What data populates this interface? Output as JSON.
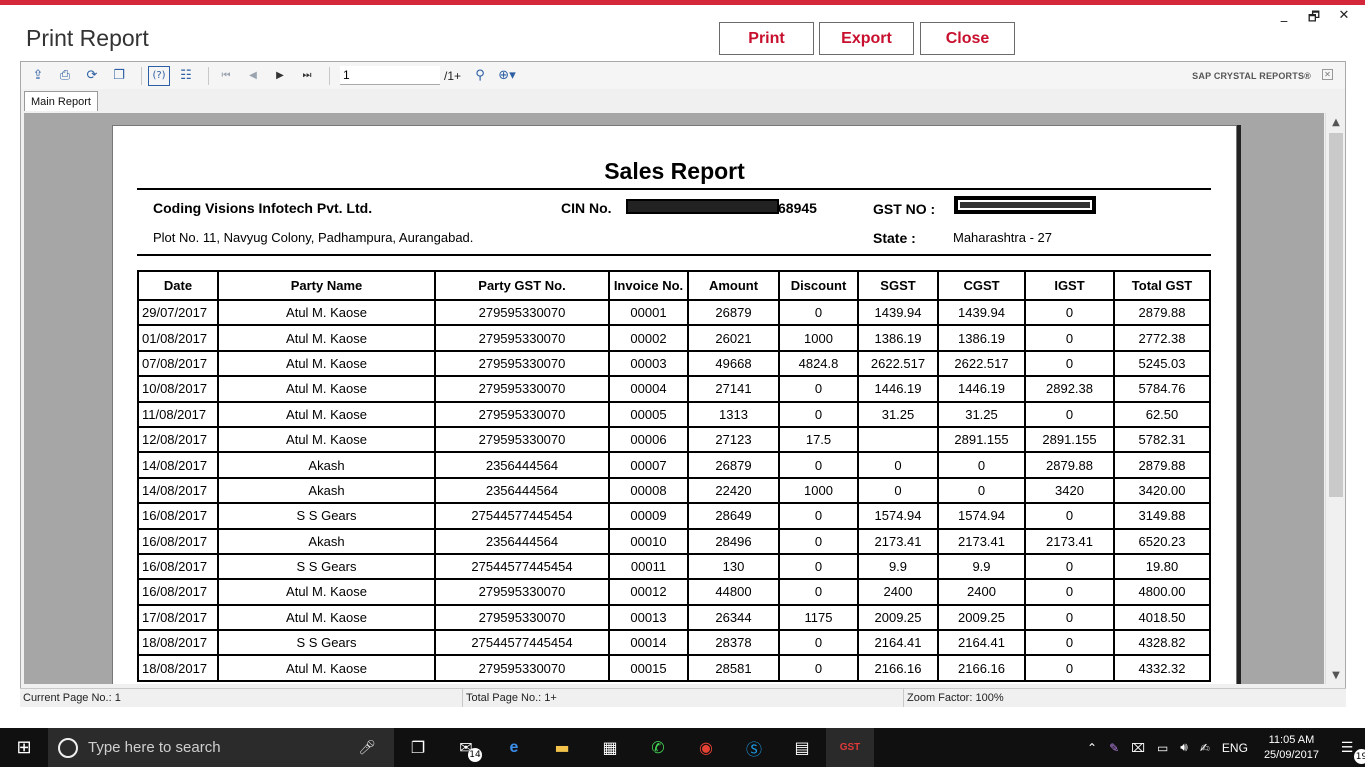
{
  "window": {
    "title": "Print Report",
    "buttons": {
      "print": "Print",
      "export": "Export",
      "close": "Close"
    },
    "controls": {
      "minimize": "_",
      "restore": "🗗",
      "close": "✕"
    }
  },
  "viewer": {
    "page_input": "1",
    "page_of": "/1+",
    "brand": "SAP CRYSTAL REPORTS®",
    "tab": "Main Report",
    "toolbar_icons": [
      "export-icon",
      "print-icon",
      "refresh-icon",
      "copy-icon",
      "help-icon",
      "group-tree-icon",
      "first-page-icon",
      "prev-page-icon",
      "next-page-icon",
      "last-page-icon",
      "find-icon",
      "zoom-icon"
    ]
  },
  "report": {
    "title": "Sales Report",
    "company_name": "Coding Visions Infotech Pvt. Ltd.",
    "address": "Plot No. 11, Navyug Colony, Padhampura, Aurangabad.",
    "cin_label": "CIN No.",
    "cin_value": "68945",
    "gst_label": "GST NO :",
    "state_label": "State :",
    "state_value": "Maharashtra - 27",
    "columns": [
      "Date",
      "Party Name",
      "Party GST No.",
      "Invoice No.",
      "Amount",
      "Discount",
      "SGST",
      "CGST",
      "IGST",
      "Total GST"
    ],
    "rows": [
      [
        "29/07/2017",
        "Atul M. Kaose",
        "279595330070",
        "00001",
        "26879",
        "0",
        "1439.94",
        "1439.94",
        "0",
        "2879.88"
      ],
      [
        "01/08/2017",
        "Atul M. Kaose",
        "279595330070",
        "00002",
        "26021",
        "1000",
        "1386.19",
        "1386.19",
        "0",
        "2772.38"
      ],
      [
        "07/08/2017",
        "Atul M. Kaose",
        "279595330070",
        "00003",
        "49668",
        "4824.8",
        "2622.517",
        "2622.517",
        "0",
        "5245.03"
      ],
      [
        "10/08/2017",
        "Atul M. Kaose",
        "279595330070",
        "00004",
        "27141",
        "0",
        "1446.19",
        "1446.19",
        "2892.38",
        "5784.76"
      ],
      [
        "11/08/2017",
        "Atul M. Kaose",
        "279595330070",
        "00005",
        "1313",
        "0",
        "31.25",
        "31.25",
        "0",
        "62.50"
      ],
      [
        "12/08/2017",
        "Atul M. Kaose",
        "279595330070",
        "00006",
        "27123",
        "17.5",
        "",
        "2891.155",
        "2891.155",
        "5782.31"
      ],
      [
        "14/08/2017",
        "Akash",
        "2356444564",
        "00007",
        "26879",
        "0",
        "0",
        "0",
        "2879.88",
        "2879.88"
      ],
      [
        "14/08/2017",
        "Akash",
        "2356444564",
        "00008",
        "22420",
        "1000",
        "0",
        "0",
        "3420",
        "3420.00"
      ],
      [
        "16/08/2017",
        "S S Gears",
        "27544577445454",
        "00009",
        "28649",
        "0",
        "1574.94",
        "1574.94",
        "0",
        "3149.88"
      ],
      [
        "16/08/2017",
        "Akash",
        "2356444564",
        "00010",
        "28496",
        "0",
        "2173.41",
        "2173.41",
        "2173.41",
        "6520.23"
      ],
      [
        "16/08/2017",
        "S S Gears",
        "27544577445454",
        "00011",
        "130",
        "0",
        "9.9",
        "9.9",
        "0",
        "19.80"
      ],
      [
        "16/08/2017",
        "Atul M. Kaose",
        "279595330070",
        "00012",
        "44800",
        "0",
        "2400",
        "2400",
        "0",
        "4800.00"
      ],
      [
        "17/08/2017",
        "Atul M. Kaose",
        "279595330070",
        "00013",
        "26344",
        "1175",
        "2009.25",
        "2009.25",
        "0",
        "4018.50"
      ],
      [
        "18/08/2017",
        "S S Gears",
        "27544577445454",
        "00014",
        "28378",
        "0",
        "2164.41",
        "2164.41",
        "0",
        "4328.82"
      ],
      [
        "18/08/2017",
        "Atul M. Kaose",
        "279595330070",
        "00015",
        "28581",
        "0",
        "2166.16",
        "2166.16",
        "0",
        "4332.32"
      ]
    ]
  },
  "status": {
    "current_page": "Current Page No.: 1",
    "total_page": "Total Page No.: 1+",
    "zoom": "Zoom Factor: 100%"
  },
  "taskbar": {
    "search_placeholder": "Type here to search",
    "mail_badge": "14",
    "apps": [
      "task-view-icon",
      "mail-icon",
      "edge-icon",
      "file-explorer-icon",
      "calculator-icon",
      "whatsapp-icon",
      "chrome-icon",
      "skype-icon",
      "settings-app-icon",
      "gst-app-icon"
    ],
    "language": "ENG",
    "time": "11:05 AM",
    "date": "25/09/2017",
    "notification_badge": "19"
  }
}
